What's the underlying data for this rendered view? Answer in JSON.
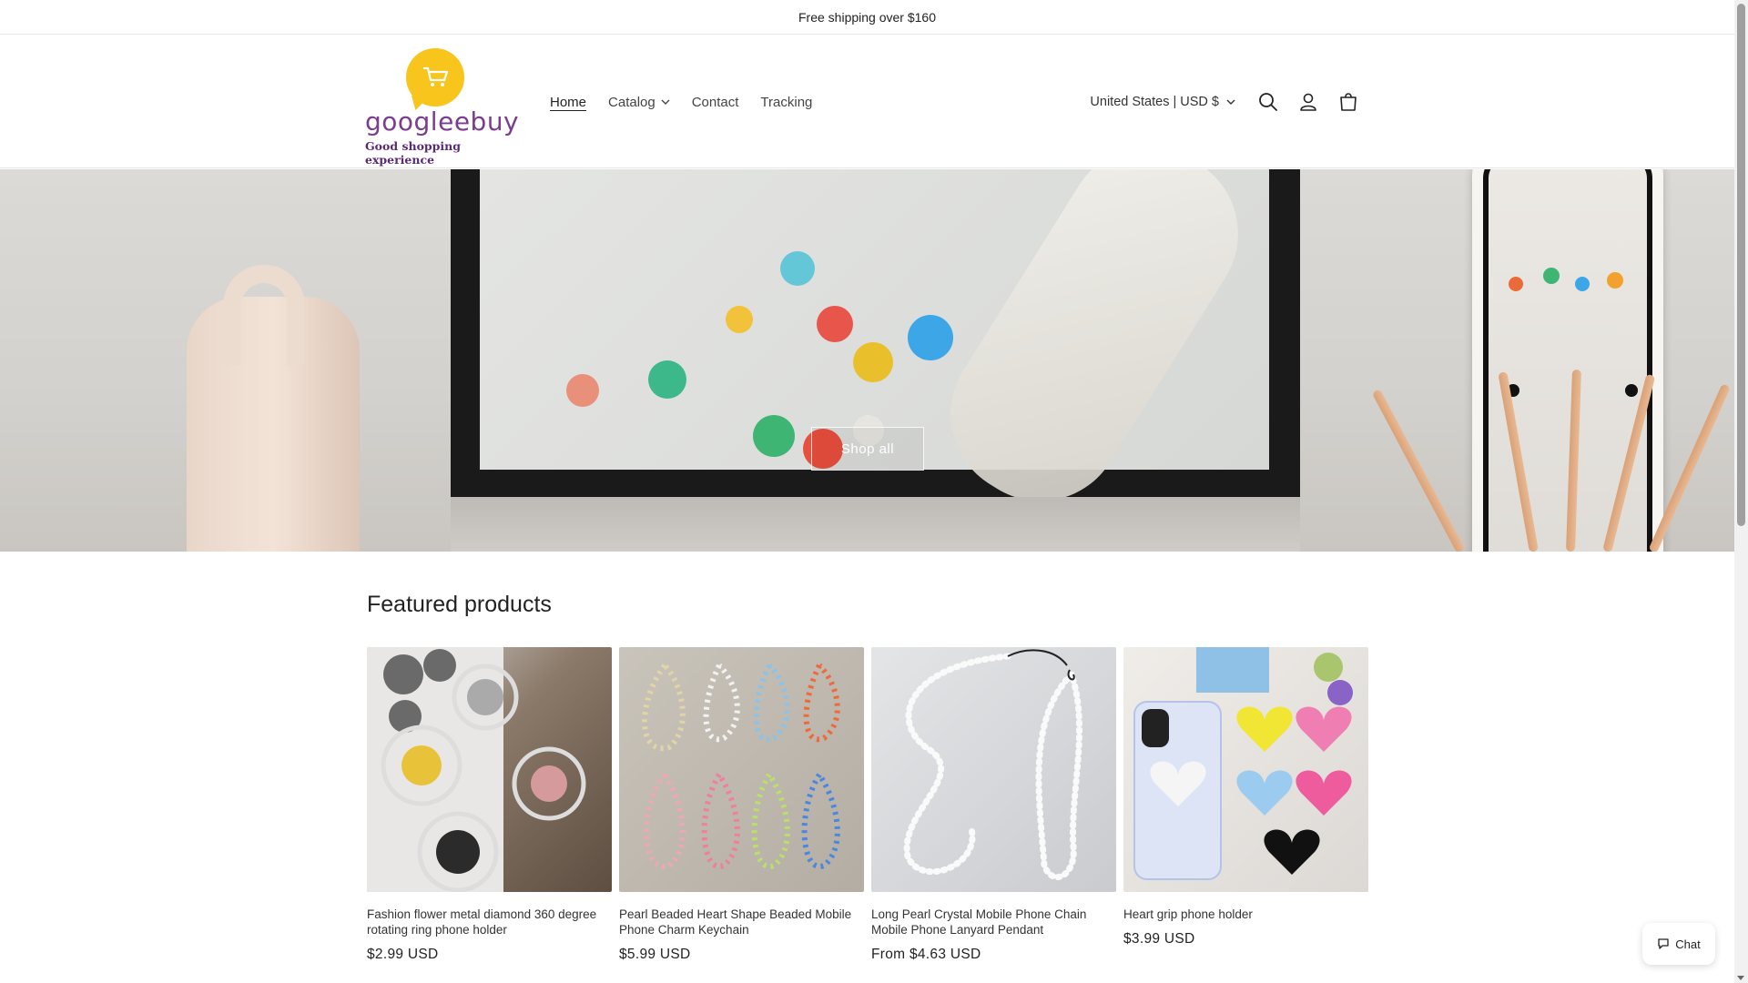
{
  "announcement": {
    "text": "Free shipping over $160"
  },
  "logo": {
    "wordmark": "googleebuy",
    "tagline": "Good shopping experience",
    "brand_color": "#7a3d8f",
    "accent_color": "#f7c51b",
    "icon": "cart-icon"
  },
  "nav": {
    "items": [
      {
        "label": "Home",
        "active": true
      },
      {
        "label": "Catalog",
        "has_dropdown": true
      },
      {
        "label": "Contact"
      },
      {
        "label": "Tracking"
      }
    ]
  },
  "header_right": {
    "locale": "United States | USD $",
    "icons": [
      "search-icon",
      "account-icon",
      "cart-icon"
    ]
  },
  "hero": {
    "button_label": "Shop all"
  },
  "featured": {
    "title": "Featured products",
    "products": [
      {
        "title": "Fashion flower metal diamond 360 degree rotating ring phone holder",
        "price": "$2.99 USD"
      },
      {
        "title": "Pearl Beaded Heart Shape Beaded Mobile Phone Charm Keychain",
        "price": "$5.99 USD"
      },
      {
        "title": "Long Pearl Crystal Mobile Phone Chain Mobile Phone Lanyard Pendant",
        "price": "From $4.63 USD"
      },
      {
        "title": "Heart grip phone holder",
        "price": "$3.99 USD"
      }
    ]
  },
  "chat": {
    "label": "Chat",
    "icon": "chat-bubble-icon"
  }
}
